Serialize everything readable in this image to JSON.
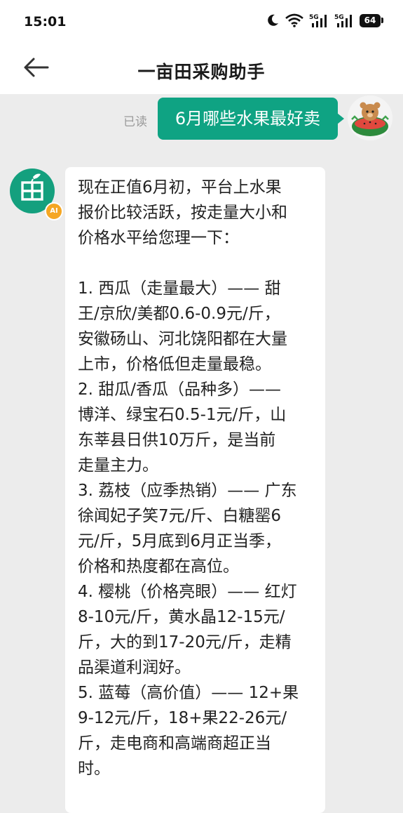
{
  "status_bar": {
    "time": "15:01",
    "signal_1_label": "5G",
    "signal_2_label": "5G",
    "battery": "64",
    "icons": [
      "moon-icon",
      "wifi-icon",
      "signal-icon",
      "signal-icon",
      "battery-icon"
    ]
  },
  "header": {
    "title": "一亩田采购助手",
    "back_icon": "arrow-left-icon"
  },
  "chat": {
    "read_label": "已读",
    "user_message": "6月哪些水果最好卖",
    "bot_badge": "AI",
    "bot_lines": [
      "现在正值6月初，平台上水果",
      "报价比较活跃，按走量大小和",
      "价格水平给您理一下：",
      "",
      "1. 西瓜（走量最大）—— 甜",
      "王/京欣/美都0.6-0.9元/斤，",
      "安徽砀山、河北饶阳都在大量",
      "上市，价格低但走量最稳。",
      "2. 甜瓜/香瓜（品种多）——",
      "博洋、绿宝石0.5-1元/斤，山",
      "东莘县日供10万斤，是当前",
      "走量主力。",
      "3. 荔枝（应季热销）—— 广东",
      "徐闻妃子笑7元/斤、白糖罂6",
      "元/斤，5月底到6月正当季，",
      "价格和热度都在高位。",
      "4. 樱桃（价格亮眼）—— 红灯",
      "8-10元/斤，黄水晶12-15元/",
      "斤，大的到17-20元/斤，走精",
      "品渠道利润好。",
      "5. 蓝莓（高价值）—— 12+果",
      "9-12元/斤，18+果22-26元/",
      "斤，走电商和高端商超正当",
      "时。"
    ]
  },
  "colors": {
    "accent": "#0fa383",
    "bot_avatar": "#14a07e",
    "ai_badge": "#f5a623",
    "background": "#ececec"
  }
}
